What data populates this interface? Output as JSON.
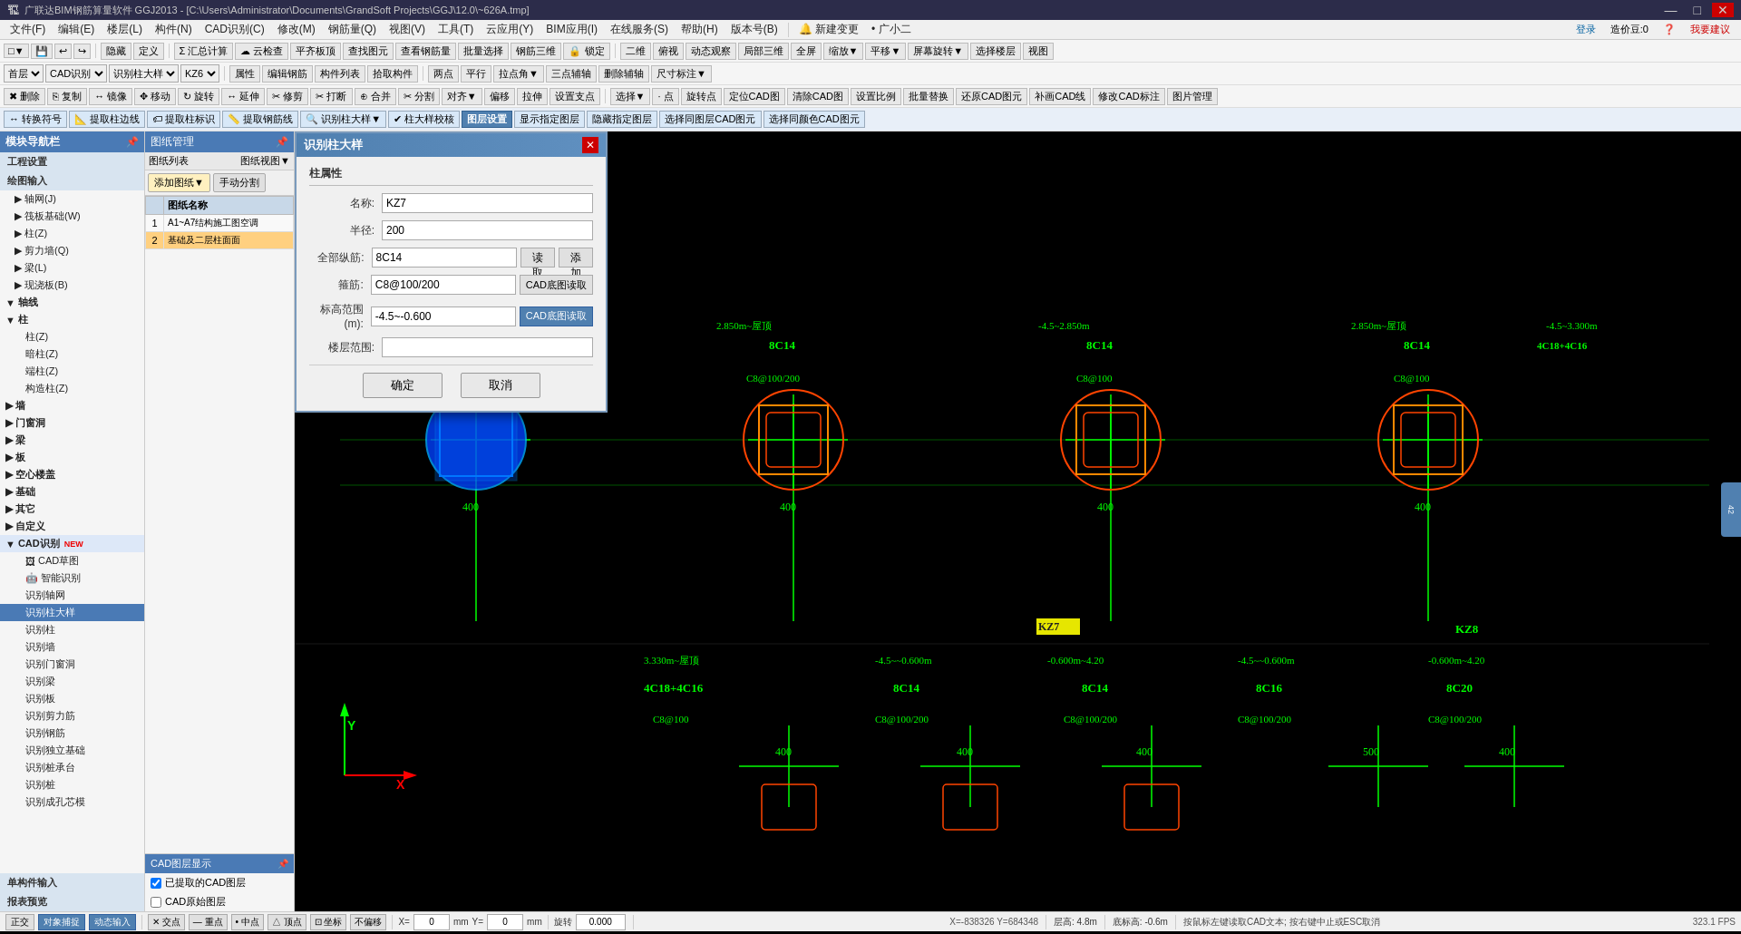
{
  "titlebar": {
    "title": "广联达BIM钢筋算量软件 GGJ2013 - [C:\\Users\\Administrator\\Documents\\GrandSoft Projects\\GGJ\\12.0\\~626A.tmp]",
    "minimize": "—",
    "maximize": "□",
    "close": "✕"
  },
  "menubar": {
    "items": [
      "文件(F)",
      "编辑(E)",
      "楼层(L)",
      "构件(N)",
      "CAD识别(C)",
      "修改(M)",
      "钢筋量(Q)",
      "视图(V)",
      "工具(T)",
      "云应用(Y)",
      "BIM应用(I)",
      "在线服务(S)",
      "帮助(H)",
      "版本号(B)",
      "新建变更",
      "广小二"
    ]
  },
  "toolbar": {
    "row1_items": [
      "□▼",
      "↩",
      "↪",
      "·",
      "隐藏",
      "·",
      "定义",
      "Σ",
      "汇总计算",
      "云检查",
      "平齐板顶",
      "查找图元",
      "查看钢筋量",
      "批量选择",
      "钢筋三维",
      "锁定",
      "»",
      "二维",
      "俯视",
      "动态观察",
      "局部三维",
      "全屏",
      "缩放▼",
      "平移▼",
      "屏幕旋转▼",
      "选择楼层",
      "视图"
    ],
    "row2_items": [
      "删除",
      "复制",
      "镜像",
      "移动",
      "旋转",
      "延伸",
      "修剪",
      "打断",
      "合并",
      "分割",
      "对齐▼",
      "偏移",
      "拉伸",
      "设置支点"
    ],
    "row2_prefix": [
      "首层▼",
      "CAD识别▼",
      "识别柱大样▼",
      "KZ6▼",
      "属性",
      "编辑钢筋",
      "构件列表",
      "拾取构件",
      "两点",
      "平行",
      "拉点角▼",
      "三点辅轴",
      "删除辅轴",
      "尺寸标注▼"
    ],
    "row3_items": [
      "选择▼",
      "·点",
      "旋转点",
      "定位CAD图",
      "清除CAD图",
      "设置比例",
      "批量替换",
      "还原CAD图元",
      "补画CAD线",
      "修改CAD标注",
      "图片管理"
    ],
    "row4_items": [
      "转换符号",
      "提取柱边线",
      "提取柱标识",
      "提取钢筋线",
      "识别柱大样▼",
      "柱大样校核",
      "图层设置",
      "显示指定图层",
      "隐藏指定图层",
      "选择同图层CAD图元",
      "选择同颜色CAD图元"
    ]
  },
  "sidebar": {
    "header": "模块导航栏",
    "sections": [
      {
        "name": "工程设置",
        "items": []
      },
      {
        "name": "绘图输入",
        "items": [
          {
            "label": "轴网(J)",
            "indent": 1
          },
          {
            "label": "筏板基础(W)",
            "indent": 1
          },
          {
            "label": "柱(Z)",
            "indent": 1
          },
          {
            "label": "剪力墙(Q)",
            "indent": 1
          },
          {
            "label": "梁(L)",
            "indent": 1
          },
          {
            "label": "现浇板(B)",
            "indent": 1
          },
          {
            "label": "轴线",
            "indent": 0,
            "expanded": true
          },
          {
            "label": "柱",
            "indent": 0,
            "expanded": true
          },
          {
            "label": "柱(Z)",
            "indent": 1
          },
          {
            "label": "暗柱(Z)",
            "indent": 1
          },
          {
            "label": "端柱(Z)",
            "indent": 1
          },
          {
            "label": "构造柱(Z)",
            "indent": 1
          },
          {
            "label": "墙",
            "indent": 0
          },
          {
            "label": "门窗洞",
            "indent": 0
          },
          {
            "label": "梁",
            "indent": 0
          },
          {
            "label": "板",
            "indent": 0
          },
          {
            "label": "空心楼盖",
            "indent": 0
          },
          {
            "label": "基础",
            "indent": 0
          },
          {
            "label": "其它",
            "indent": 0
          },
          {
            "label": "自定义",
            "indent": 0
          },
          {
            "label": "CAD识别 NEW",
            "indent": 0,
            "expanded": true
          },
          {
            "label": "CAD草图",
            "indent": 1
          },
          {
            "label": "智能识别",
            "indent": 1
          },
          {
            "label": "识别轴网",
            "indent": 1
          },
          {
            "label": "识别柱大样",
            "indent": 1,
            "selected": true
          },
          {
            "label": "识别柱",
            "indent": 1
          },
          {
            "label": "识别墙",
            "indent": 1
          },
          {
            "label": "识别门窗洞",
            "indent": 1
          },
          {
            "label": "识别梁",
            "indent": 1
          },
          {
            "label": "识别板",
            "indent": 1
          },
          {
            "label": "识别剪力筋",
            "indent": 1
          },
          {
            "label": "识别钢筋",
            "indent": 1
          },
          {
            "label": "识别独立基础",
            "indent": 1
          },
          {
            "label": "识别桩承台",
            "indent": 1
          },
          {
            "label": "识别桩",
            "indent": 1
          },
          {
            "label": "识别成孔芯模",
            "indent": 1
          }
        ]
      },
      {
        "name": "单构件输入",
        "items": []
      },
      {
        "name": "报表预览",
        "items": []
      }
    ]
  },
  "drawing_panel": {
    "header": "图纸管理",
    "toolbar": [
      "添加图纸▼",
      "手动分割"
    ],
    "table": {
      "columns": [
        "",
        "图纸名称"
      ],
      "rows": [
        {
          "num": "1",
          "name": "A1~A7结构施工图空调"
        },
        {
          "num": "2",
          "name": "基础及二层柱面面",
          "selected": true
        }
      ]
    },
    "panel2_header": "图纸列表",
    "panel2_btn": "图纸视图▼"
  },
  "cad_layers": {
    "header": "CAD图层显示",
    "layers": [
      {
        "name": "已提取的CAD图层",
        "checked": true
      },
      {
        "name": "CAD原始图层",
        "checked": false
      }
    ]
  },
  "dialog": {
    "title": "识别柱大样",
    "close_btn": "✕",
    "section": "柱属性",
    "fields": [
      {
        "label": "名称:",
        "value": "KZ7",
        "input_type": "text",
        "buttons": []
      },
      {
        "label": "半径:",
        "value": "200",
        "input_type": "text",
        "buttons": []
      },
      {
        "label": "全部纵筋:",
        "value": "8C14",
        "input_type": "text",
        "buttons": [
          "读取",
          "添加"
        ]
      },
      {
        "label": "箍筋:",
        "value": "C8@100/200",
        "input_type": "text",
        "buttons": [
          "CAD底图读取"
        ]
      },
      {
        "label": "标高范围(m):",
        "value": "-4.5~-0.600",
        "input_type": "text",
        "buttons": [
          "CAD底图读取"
        ]
      },
      {
        "label": "楼层范围:",
        "value": "",
        "input_type": "text",
        "buttons": []
      }
    ],
    "footer": {
      "ok": "确定",
      "cancel": "取消"
    }
  },
  "cad_content": {
    "green_labels": [
      "-4.5~2.850m",
      "2.850m~屋顶",
      "-4.5~2.850m",
      "2.850m~屋顶",
      "-4.5~3.300m",
      "8C14",
      "8C14",
      "8C14",
      "8C14",
      "4C18+4C16",
      "C8@100",
      "C8@100/200",
      "C8@100",
      "C8@100",
      "400",
      "400",
      "400",
      "400",
      "3.330m~屋顶",
      "-4.5~~0.600m",
      "-0.600m~4.20",
      "-4.5~~0.600m",
      "-0.600m~4.20",
      "4C18+4C16",
      "8C14",
      "8C14",
      "8C16",
      "8C20",
      "C8@100",
      "C8@100/200",
      "C8@100/200",
      "C8@100/200",
      "C8@100/200",
      "400",
      "400",
      "400",
      "500",
      "400"
    ],
    "yellow_labels": [
      "KZ7",
      "KZ8"
    ],
    "column_labels": [
      "KZ8"
    ]
  },
  "statusbar": {
    "coord_x": "X= -838326",
    "coord_y": "Y= 684348",
    "floor_height": "层高: 4.8m",
    "base_height": "底标高: -0.6m",
    "value": "0",
    "hint": "按鼠标左键读取CAD文本; 按右键中止或ESC取消",
    "angle": "0.000",
    "buttons": [
      "正交",
      "对象捕捉",
      "动态输入",
      "×交点",
      "— 重点",
      "• 中点",
      "△ 顶点",
      "⊡ 坐标",
      "不偏移"
    ],
    "status_right": "323.1 FPS",
    "coor_label_x": "X=",
    "coor_label_y": "Y=",
    "mm_x": "mm",
    "mm_y": "mm",
    "rotate_label": "旋转"
  }
}
